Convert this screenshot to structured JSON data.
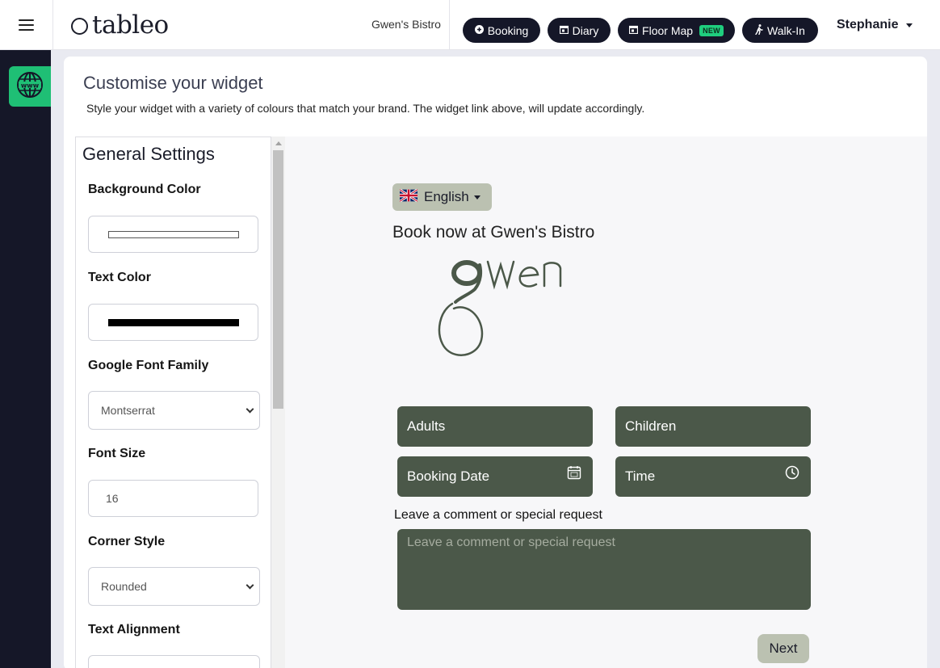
{
  "topbar": {
    "brand": "tableo",
    "restaurant": "Gwen's Bistro",
    "nav": [
      {
        "label": "Booking",
        "icon": "plus-circle-icon"
      },
      {
        "label": "Diary",
        "icon": "calendar-icon"
      },
      {
        "label": "Floor Map",
        "icon": "calendar-icon",
        "badge": "NEW"
      },
      {
        "label": "Walk-In",
        "icon": "walking-icon"
      }
    ],
    "user": "Stephanie"
  },
  "page": {
    "title": "Customise your widget",
    "description": "Style your widget with a variety of colours that match your brand. The widget link above, will update accordingly."
  },
  "settings": {
    "title": "General Settings",
    "background_color_label": "Background Color",
    "background_color": "#ffffff",
    "text_color_label": "Text Color",
    "text_color": "#000000",
    "font_family_label": "Google Font Family",
    "font_family_value": "Montserrat",
    "font_size_label": "Font Size",
    "font_size_value": "16",
    "corner_style_label": "Corner Style",
    "corner_style_value": "Rounded",
    "text_alignment_label": "Text Alignment"
  },
  "preview": {
    "language": "English",
    "book_title": "Book now at Gwen's Bistro",
    "fields": {
      "adults": "Adults",
      "children": "Children",
      "booking_date": "Booking Date",
      "time": "Time"
    },
    "comment_label": "Leave a comment or special request",
    "comment_placeholder": "Leave a comment or special request",
    "next": "Next",
    "accent_color": "#4b5849",
    "button_color": "#bbc1b1"
  }
}
